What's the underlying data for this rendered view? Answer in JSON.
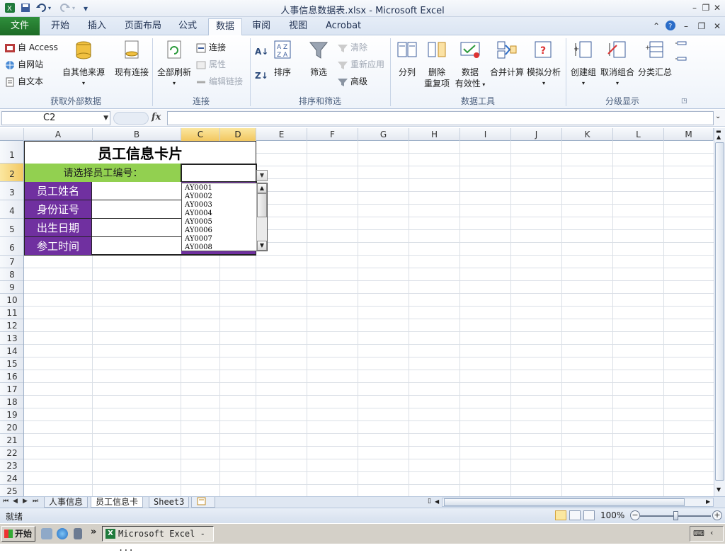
{
  "window": {
    "title": "人事信息数据表.xlsx  -  Microsoft Excel",
    "qat_dropdown": "▾",
    "min": "–",
    "max": "❐",
    "close": "✕"
  },
  "tabs": [
    {
      "label": "文件"
    },
    {
      "label": "开始"
    },
    {
      "label": "插入"
    },
    {
      "label": "页面布局"
    },
    {
      "label": "公式"
    },
    {
      "label": "数据"
    },
    {
      "label": "审阅"
    },
    {
      "label": "视图"
    },
    {
      "label": "Acrobat"
    }
  ],
  "active_tab": "数据",
  "ribbon": {
    "ext": {
      "access": "自 Access",
      "web": "自网站",
      "text": "自文本",
      "other": "自其他来源",
      "existing": "现有连接",
      "label": "获取外部数据"
    },
    "conn": {
      "refresh": "全部刷新",
      "connections": "连接",
      "properties": "属性",
      "edit_links": "编辑链接",
      "label": "连接"
    },
    "sort": {
      "sort": "排序",
      "filter": "筛选",
      "clear": "清除",
      "reapply": "重新应用",
      "advanced": "高级",
      "label": "排序和筛选",
      "az": "A↓",
      "za": "Z↓"
    },
    "tools": {
      "split": "分列",
      "remove_dup_1": "删除",
      "remove_dup_2": "重复项",
      "validation_1": "数据",
      "validation_2": "有效性",
      "consolidate": "合并计算",
      "whatif": "模拟分析",
      "label": "数据工具"
    },
    "outline": {
      "group": "创建组",
      "ungroup": "取消组合",
      "subtotal": "分类汇总",
      "label": "分级显示"
    }
  },
  "formula_bar": {
    "name_box": "C2",
    "fx": "fx",
    "value": ""
  },
  "columns": [
    "A",
    "B",
    "C",
    "D",
    "E",
    "F",
    "G",
    "H",
    "I",
    "J",
    "K",
    "L",
    "M"
  ],
  "rows": [
    "1",
    "2",
    "3",
    "4",
    "5",
    "6",
    "7",
    "8",
    "9",
    "10",
    "11",
    "12",
    "13",
    "14",
    "15",
    "16",
    "17",
    "18",
    "19",
    "20",
    "21",
    "22",
    "23",
    "24",
    "25"
  ],
  "card": {
    "title": "员工信息卡片",
    "prompt": "请选择员工编号：",
    "fields": [
      "员工姓名",
      "身份证号",
      "出生日期",
      "参工时间"
    ]
  },
  "dropdown": {
    "options": [
      "AY0001",
      "AY0002",
      "AY0003",
      "AY0004",
      "AY0005",
      "AY0006",
      "AY0007",
      "AY0008"
    ]
  },
  "sheets": [
    {
      "label": "人事信息"
    },
    {
      "label": "员工信息卡"
    },
    {
      "label": "Sheet3"
    }
  ],
  "active_sheet": "员工信息卡",
  "status": {
    "ready": "就绪",
    "zoom": "100%"
  },
  "taskbar": {
    "start": "开始",
    "item": "Microsoft Excel - ...",
    "more": "»"
  },
  "colors": {
    "purple": "#7030a0",
    "green": "#92d050",
    "file_tab": "#1d6b26",
    "selection_header": "#f2c760"
  }
}
